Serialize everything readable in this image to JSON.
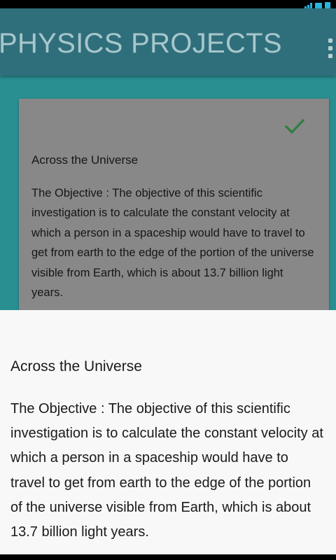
{
  "app_bar": {
    "title": "PHYSICS PROJECTS",
    "overflow_icon": "overflow-menu-icon"
  },
  "status_bar": {
    "icons": [
      "signal-icon",
      "wifi-icon",
      "battery-icon"
    ],
    "accent_color": "#27b6e0"
  },
  "card": {
    "checked_icon": "check-icon",
    "title": "Across the Universe",
    "body": "The Objective : The objective of this scientific investigation is to calculate the constant velocity at which a person in a spaceship would have to travel to get from earth to the edge of the portion of the universe visible from Earth, which is about 13.7 billion light years."
  },
  "bottom_sheet": {
    "title": "Across the Universe",
    "body": "The Objective : The objective of this scientific investigation is to calculate the constant velocity at which a person in a spaceship would have to travel to get from earth to the edge of the portion of the universe visible from Earth, which is about 13.7 billion light years."
  },
  "colors": {
    "background_teal": "#2a8f90",
    "app_bar": "#2f6f7b",
    "card_gray": "#888888",
    "check_green": "#2f7d3e",
    "sheet_background": "#f8f8f8"
  }
}
